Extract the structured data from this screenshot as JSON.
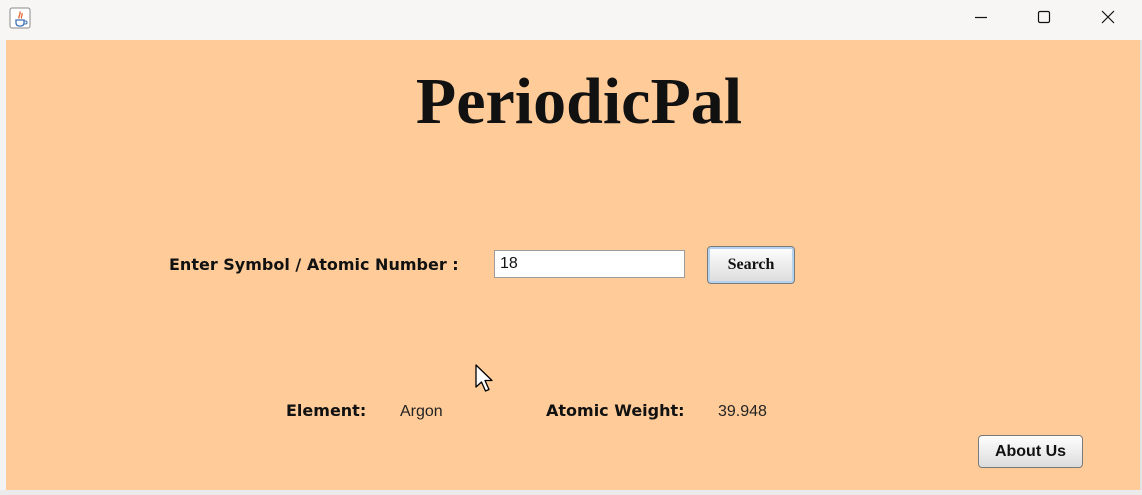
{
  "window": {
    "icon": "java-cup-icon",
    "controls": [
      "minimize-icon",
      "maximize-icon",
      "close-icon"
    ]
  },
  "app": {
    "title": "PeriodicPal",
    "background_color": "#ffcc99"
  },
  "search": {
    "label": "Enter Symbol / Atomic Number :",
    "value": "18",
    "button_label": "Search"
  },
  "result": {
    "element_label": "Element:",
    "element_value": "Argon",
    "weight_label": "Atomic Weight:",
    "weight_value": "39.948"
  },
  "footer": {
    "about_label": "About Us"
  }
}
